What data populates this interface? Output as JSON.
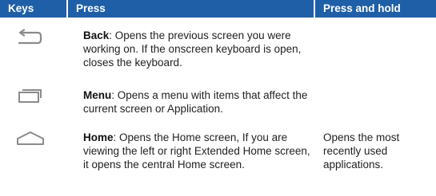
{
  "header": {
    "keys": "Keys",
    "press": "Press",
    "press_and_hold": "Press and hold"
  },
  "rows": [
    {
      "icon": "back-icon",
      "key_name": "Back",
      "press_desc": ": Opens the previous screen you were working on. If the onscreen keyboard is open, closes the keyboard.",
      "hold_desc": ""
    },
    {
      "icon": "menu-icon",
      "key_name": "Menu",
      "press_desc": ": Opens a menu with items that affect the current screen or Application.",
      "hold_desc": ""
    },
    {
      "icon": "home-icon",
      "key_name": "Home",
      "press_desc": ": Opens the Home screen, If you are viewing the left or right Extended Home screen, it opens the central Home screen.",
      "hold_desc": "Opens the most recently used applications."
    }
  ],
  "colors": {
    "header_bg": "#1f5fa8",
    "header_text": "#ffffff",
    "icon_stroke": "#8a8a8a"
  }
}
